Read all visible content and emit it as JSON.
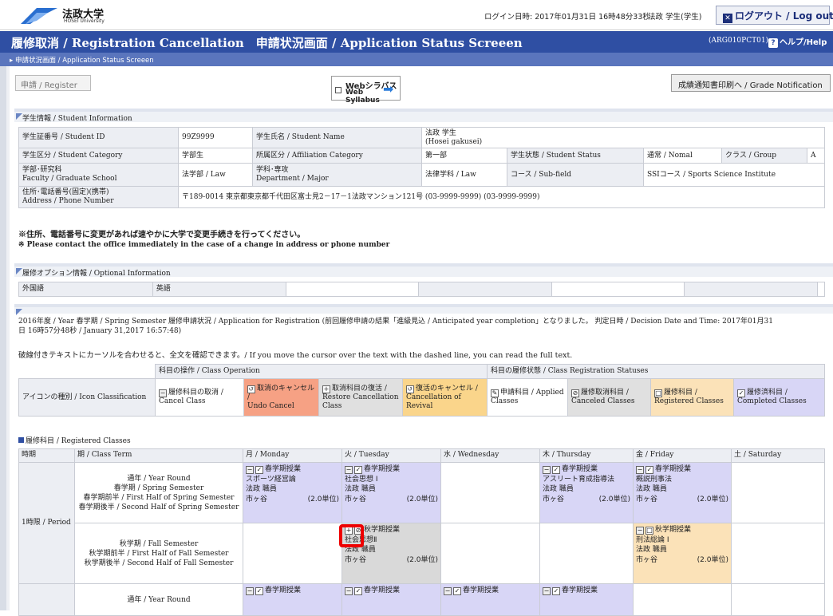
{
  "top": {
    "logo": "法政大学",
    "logo_sub": "HOSEI University",
    "login": "ログイン日時: 2017年01月31日 16時48分33秒",
    "user": "法政 学生(学生)",
    "logout": "ログアウト / Log out"
  },
  "header": {
    "title": "履修取消 / Registration Cancellation　申請状況画面 / Application Status Screeen",
    "screen_id": "(ARG010PCT01)",
    "help": "ヘルプ/Help"
  },
  "breadcrumb": "申請状況画面 / Application Status Screeen",
  "toolbar": {
    "register": "申請 / Register",
    "syllabus1": "Webシラバス",
    "syllabus2": "Web Syllabus",
    "grade": "成績通知書印刷へ / Grade Notification"
  },
  "student": {
    "header": "学生情報 / Student Information",
    "id_label": "学生証番号 / Student ID",
    "id": "99Z9999",
    "name_label": "学生氏名 / Student Name",
    "name1": "法政 学生",
    "name2": "(Hosei gakusei)",
    "cat_label": "学生区分 / Student Category",
    "cat": "学部生",
    "aff_label": "所属区分 / Affiliation Category",
    "aff": "第一部",
    "status_label": "学生状態 / Student Status",
    "status": "通常 / Nomal",
    "group_label": "クラス / Group",
    "group": "A",
    "fac_label1": "学部･研究科",
    "fac_label2": "Faculty / Graduate School",
    "fac": "法学部 / Law",
    "dept_label1": "学科･専攻",
    "dept_label2": "Department / Major",
    "dept": "法律学科 / Law",
    "course_label": "コース / Sub-field",
    "course": "SSIコース / Sports Science Institute",
    "addr_label1": "住所･電話番号(固定)(携帯)",
    "addr_label2": "Address / Phone Number",
    "addr": "〒189-0014  東京都東京都千代田区富士見2－17－1法政マンション121号  (03-9999-9999)  (03-9999-9999)"
  },
  "notice": {
    "jp": "※住所、電話番号に変更があれば速やかに大学で変更手続きを行ってください。",
    "en": "※ Please contact the office immediately in the case of a change in address or phone number"
  },
  "options": {
    "header": "履修オプション情報 / Optional Information",
    "lang_label": "外国語",
    "lang": "英語"
  },
  "reg": {
    "status1": "2016年度 / Year  春学期 / Spring Semester   履修申請状況 / Application for Registration (前回履修申請の結果「進級見込 / Anticipated year completion」となりました。 判定日時 / Decision Date and Time:  2017年01月31",
    "status2": "日 16時57分48秒 / January 31,2017 16:57:48)",
    "cursor_note": "破線付きテキストにカーソルを合わせると、全文を確認できます。/ If you move the cursor over the text with the dashed line, you can read the full text."
  },
  "legend": {
    "op_header": "科目の操作 / Class Operation",
    "st_header": "科目の履修状態 / Class Registration Statuses",
    "icon_label": "アイコンの種別 / Icon Classification",
    "items": [
      {
        "jp": "履修科目の取消 /",
        "en": "Cancel Class"
      },
      {
        "jp": "取消のキャンセル /",
        "en": "Undo Cancel"
      },
      {
        "jp": "取消科目の復活 /",
        "en": "Restore Cancellation",
        "en2": "Class"
      },
      {
        "jp": "復活のキャンセル /",
        "en": "Cancellation of Revival"
      },
      {
        "jp": "申請科目 / Applied",
        "en": "Classes"
      },
      {
        "jp": "履修取消科目 /",
        "en": "Canceled Classes"
      },
      {
        "jp": "履修科目 /",
        "en": "Registered Classes"
      },
      {
        "jp": "履修済科目 /",
        "en": "Completed Classes"
      }
    ]
  },
  "schedule": {
    "title": "履修科目 / Registered Classes",
    "headers": [
      "時期",
      "期 / Class Term",
      "月 / Monday",
      "火 / Tuesday",
      "水 / Wednesday",
      "木 / Thursday",
      "金 / Friday",
      "土 / Saturday"
    ],
    "period": "1時限 / Period",
    "terms1": [
      "通年 / Year Round",
      "春学期 / Spring Semester",
      "春学期前半 / First Half of Spring Semester",
      "春学期後半 / Second Half of Spring Semester"
    ],
    "terms2": [
      "秋学期 / Fall Semester",
      "秋学期前半 / First Half of Fall Semester",
      "秋学期後半 / Second Half of Fall Semester"
    ],
    "terms3": "通年 / Year Round",
    "tag": "春学期授業",
    "tag_fall": "秋学期授業",
    "teacher": "法政 職員",
    "campus": "市ヶ谷",
    "credits": "(2.0単位)",
    "mon": "スポーツ経営論",
    "tue": "社会思想 I",
    "thu": "アスリート育成指導法",
    "fri": "概説刑事法",
    "tue2": "社会思想Ⅱ",
    "fri2": "刑法総論 I"
  }
}
